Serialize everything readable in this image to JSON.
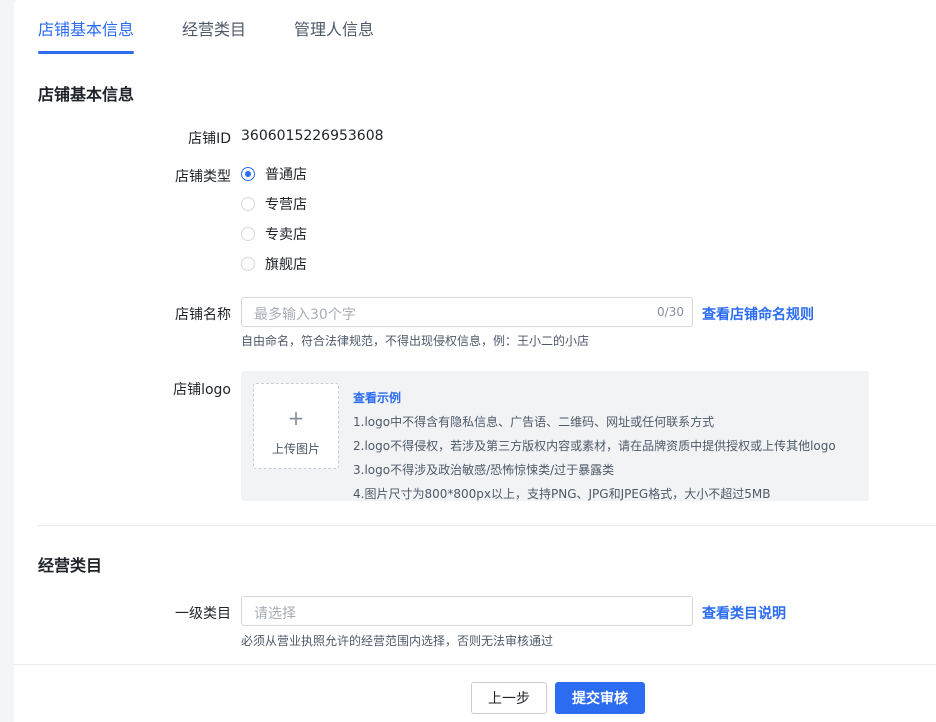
{
  "tabs": [
    {
      "label": "店铺基本信息",
      "active": true
    },
    {
      "label": "经营类目",
      "active": false
    },
    {
      "label": "管理人信息",
      "active": false
    }
  ],
  "basic_section": {
    "title": "店铺基本信息",
    "shop_id_label": "店铺ID",
    "shop_id_value": "3606015226953608",
    "shop_type_label": "店铺类型",
    "shop_types": [
      {
        "label": "普通店",
        "checked": true
      },
      {
        "label": "专营店",
        "checked": false
      },
      {
        "label": "专卖店",
        "checked": false
      },
      {
        "label": "旗舰店",
        "checked": false
      }
    ],
    "shop_name_label": "店铺名称",
    "shop_name_placeholder": "最多输入30个字",
    "shop_name_count": "0/30",
    "shop_name_rule_link": "查看店铺命名规则",
    "shop_name_hint": "自由命名，符合法律规范，不得出现侵权信息，例：王小二的小店",
    "logo_label": "店铺logo",
    "upload_text": "上传图片",
    "example_link": "查看示例",
    "logo_rules": [
      "1.logo中不得含有隐私信息、广告语、二维码、网址或任何联系方式",
      "2.logo不得侵权，若涉及第三方版权内容或素材，请在品牌资质中提供授权或上传其他logo",
      "3.logo不得涉及政治敏感/恐怖惊悚类/过于暴露类",
      "4.图片尺寸为800*800px以上，支持PNG、JPG和JPEG格式，大小不超过5MB"
    ]
  },
  "category_section": {
    "title": "经营类目",
    "level1_label": "一级类目",
    "level1_placeholder": "请选择",
    "category_link": "查看类目说明",
    "category_hint": "必须从营业执照允许的经营范围内选择，否则无法审核通过"
  },
  "footer": {
    "prev_label": "上一步",
    "submit_label": "提交审核"
  },
  "colors": {
    "accent": "#2b6cf0",
    "page_bg": "#f4f5f7",
    "logo_panel_bg": "#f2f3f5"
  }
}
